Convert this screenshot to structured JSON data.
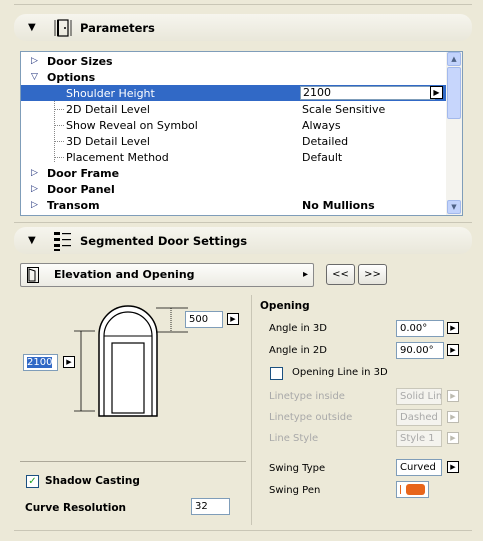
{
  "parameters_header": {
    "title": "Parameters",
    "collapse_glyph": "▼",
    "icon": "door-parameters-icon"
  },
  "property_list": {
    "rows": [
      {
        "type": "group",
        "label": "Door Sizes",
        "expander": "▷",
        "value": ""
      },
      {
        "type": "group",
        "label": "Options",
        "expander": "▽",
        "value": ""
      },
      {
        "type": "child",
        "label": "Shoulder Height",
        "value": "2100",
        "selected": true
      },
      {
        "type": "child",
        "label": "2D Detail Level",
        "value": "Scale Sensitive"
      },
      {
        "type": "child",
        "label": "Show Reveal on Symbol",
        "value": "Always"
      },
      {
        "type": "child",
        "label": "3D Detail Level",
        "value": "Detailed"
      },
      {
        "type": "child",
        "label": "Placement Method",
        "value": "Default"
      },
      {
        "type": "group",
        "label": "Door Frame",
        "expander": "▷",
        "value": ""
      },
      {
        "type": "group",
        "label": "Door Panel",
        "expander": "▷",
        "value": ""
      },
      {
        "type": "group",
        "label": "Transom",
        "expander": "▷",
        "value": "No Mullions"
      }
    ],
    "scroll_up": "▲",
    "scroll_down": "▼",
    "value_arrow": "▶"
  },
  "segmented_header": {
    "title": "Segmented Door Settings",
    "collapse_glyph": "▼",
    "icon": "segmented-door-icon"
  },
  "page_selector": {
    "label": "Elevation and Opening",
    "arrow": "▸",
    "prev": "<<",
    "next": ">>"
  },
  "preview": {
    "top_value": "500",
    "side_value": "2100",
    "arrow": "▶"
  },
  "shadow_casting": {
    "label": "Shadow Casting",
    "checked": true,
    "check": "✓"
  },
  "curve_resolution": {
    "label": "Curve Resolution",
    "value": "32"
  },
  "opening": {
    "title": "Opening",
    "angle_3d": {
      "label": "Angle in 3D",
      "value": "0.00°"
    },
    "angle_2d": {
      "label": "Angle in 2D",
      "value": "90.00°"
    },
    "opening_line_3d": {
      "label": "Opening Line in 3D",
      "checked": false
    },
    "linetype_inside": {
      "label": "Linetype inside",
      "value": "Solid Line"
    },
    "linetype_outside": {
      "label": "Linetype outside",
      "value": "Dashed"
    },
    "line_style": {
      "label": "Line Style",
      "value": "Style 1"
    },
    "swing_type": {
      "label": "Swing Type",
      "value": "Curved"
    },
    "swing_pen": {
      "label": "Swing Pen",
      "color": "#e8651a"
    }
  }
}
